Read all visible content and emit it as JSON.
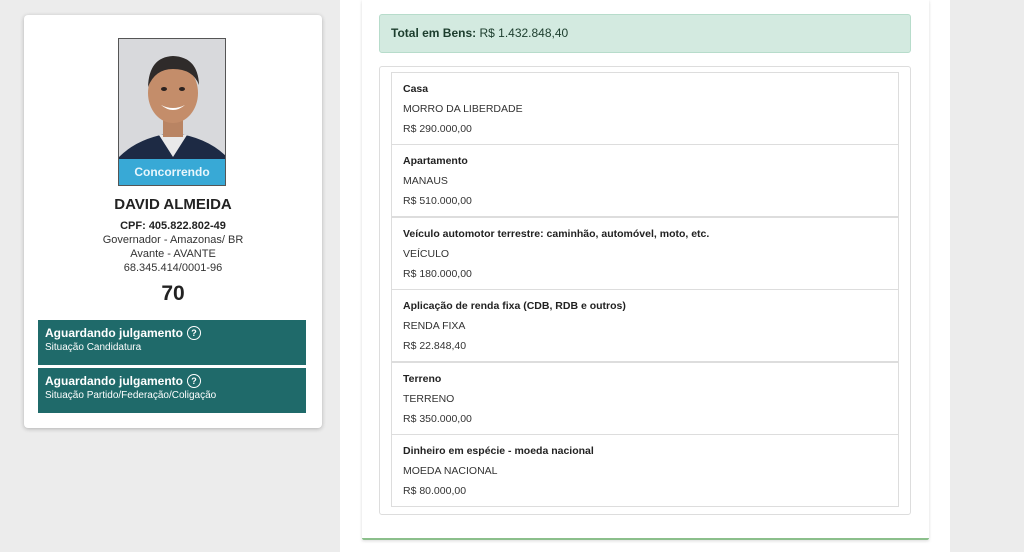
{
  "candidate": {
    "status_tag": "Concorrendo",
    "name": "DAVID ALMEIDA",
    "cpf": "CPF: 405.822.802-49",
    "office": "Governador - Amazonas/ BR",
    "party": "Avante - AVANTE",
    "cnpj": "68.345.414/0001-96",
    "number": "70",
    "situations": [
      {
        "title": "Aguardando julgamento",
        "subtitle": "Situação Candidatura",
        "icon": "help-circle-icon"
      },
      {
        "title": "Aguardando julgamento",
        "subtitle": "Situação Partido/Federação/Coligação",
        "icon": "help-circle-icon"
      }
    ]
  },
  "assets": {
    "total_label": "Total em Bens:",
    "total_value": "R$ 1.432.848,40",
    "items": [
      {
        "type": "Casa",
        "description": "MORRO DA LIBERDADE",
        "value": "R$ 290.000,00"
      },
      {
        "type": "Apartamento",
        "description": "MANAUS",
        "value": "R$ 510.000,00"
      },
      {
        "type": "Veículo automotor terrestre: caminhão, automóvel, moto, etc.",
        "description": "VEÍCULO",
        "value": "R$ 180.000,00"
      },
      {
        "type": "Aplicação de renda fixa (CDB, RDB e outros)",
        "description": "RENDA FIXA",
        "value": "R$ 22.848,40"
      },
      {
        "type": "Terreno",
        "description": "TERRENO",
        "value": "R$ 350.000,00"
      },
      {
        "type": "Dinheiro em espécie - moeda nacional",
        "description": "MOEDA NACIONAL",
        "value": "R$ 80.000,00"
      }
    ]
  },
  "colors": {
    "situation_bg": "#1f6a6a",
    "status_tag_bg": "#38a9d6",
    "total_bg": "#d3eae0"
  }
}
